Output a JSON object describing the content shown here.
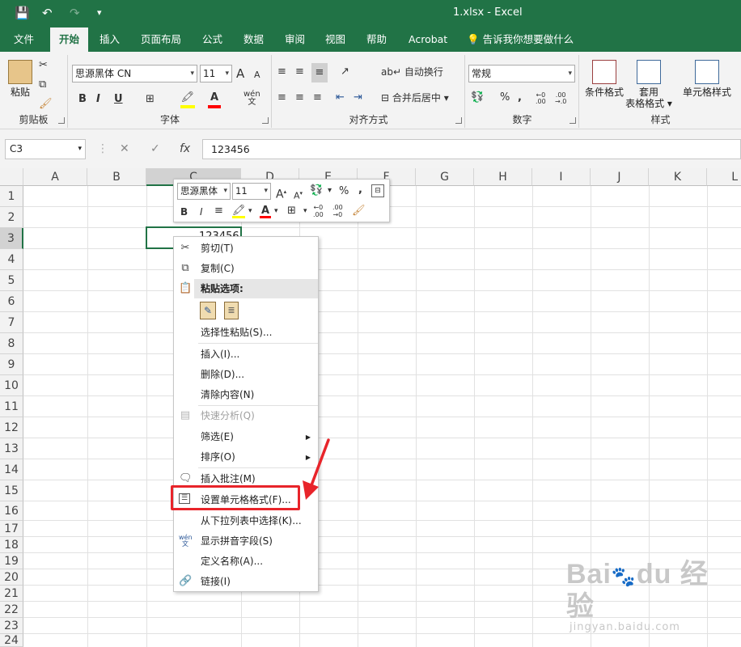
{
  "window": {
    "title": "1.xlsx  -  Excel"
  },
  "quick_access": {
    "save": "💾",
    "undo": "↶",
    "redo": "↷",
    "customize": "▾"
  },
  "ribbon_tabs": [
    "文件",
    "开始",
    "插入",
    "页面布局",
    "公式",
    "数据",
    "审阅",
    "视图",
    "帮助",
    "Acrobat"
  ],
  "tell_me": "告诉我你想要做什么",
  "ribbon": {
    "clipboard": {
      "paste": "粘贴",
      "label": "剪贴板"
    },
    "font": {
      "name": "思源黑体 CN",
      "size": "11",
      "label": "字体",
      "grow": "A",
      "shrink": "A",
      "bold": "B",
      "italic": "I",
      "underline": "U",
      "wen": "wén"
    },
    "alignment": {
      "wrap": "自动换行",
      "merge": "合并后居中",
      "label": "对齐方式"
    },
    "number": {
      "format": "常规",
      "percent": "%",
      "comma": ",",
      "inc": ".00→0",
      "dec": "0→.00",
      "label": "数字"
    },
    "styles": {
      "conditional": "条件格式",
      "table_line1": "套用",
      "table_line2": "表格格式",
      "cell": "单元格样式",
      "label": "样式"
    }
  },
  "formula_bar": {
    "name_box": "C3",
    "cancel": "✕",
    "enter": "✓",
    "fx": "fx",
    "value": "123456"
  },
  "columns": [
    "A",
    "B",
    "C",
    "D",
    "E",
    "F",
    "G",
    "H",
    "I",
    "J",
    "K",
    "L"
  ],
  "rows": [
    "1",
    "2",
    "3",
    "4",
    "5",
    "6",
    "7",
    "8",
    "9",
    "10",
    "11",
    "12",
    "13",
    "14",
    "15",
    "16",
    "17",
    "18",
    "19",
    "20",
    "21",
    "22",
    "23",
    "24"
  ],
  "cell_value": "123456",
  "mini_toolbar": {
    "font": "思源黑体",
    "size": "11",
    "percent": "%",
    "comma": ",",
    "bold": "B",
    "italic": "I",
    "inc": ".00",
    "dec": ".00"
  },
  "context_menu": {
    "cut": "剪切(T)",
    "copy": "复制(C)",
    "paste_options": "粘贴选项:",
    "paste_special": "选择性粘贴(S)...",
    "insert": "插入(I)...",
    "delete": "删除(D)...",
    "clear": "清除内容(N)",
    "quick_analysis": "快速分析(Q)",
    "filter": "筛选(E)",
    "sort": "排序(O)",
    "insert_comment": "插入批注(M)",
    "format_cells": "设置单元格格式(F)...",
    "pick_from_list": "从下拉列表中选择(K)...",
    "phonetic": "显示拼音字段(S)",
    "define_name": "定义名称(A)...",
    "link": "链接(I)"
  },
  "watermark": {
    "line1": "Bai",
    "line2": "du",
    "line3": "经验",
    "url": "jingyan.baidu.com"
  },
  "colors": {
    "excel_green": "#217346",
    "highlight_red": "#e8242a"
  }
}
